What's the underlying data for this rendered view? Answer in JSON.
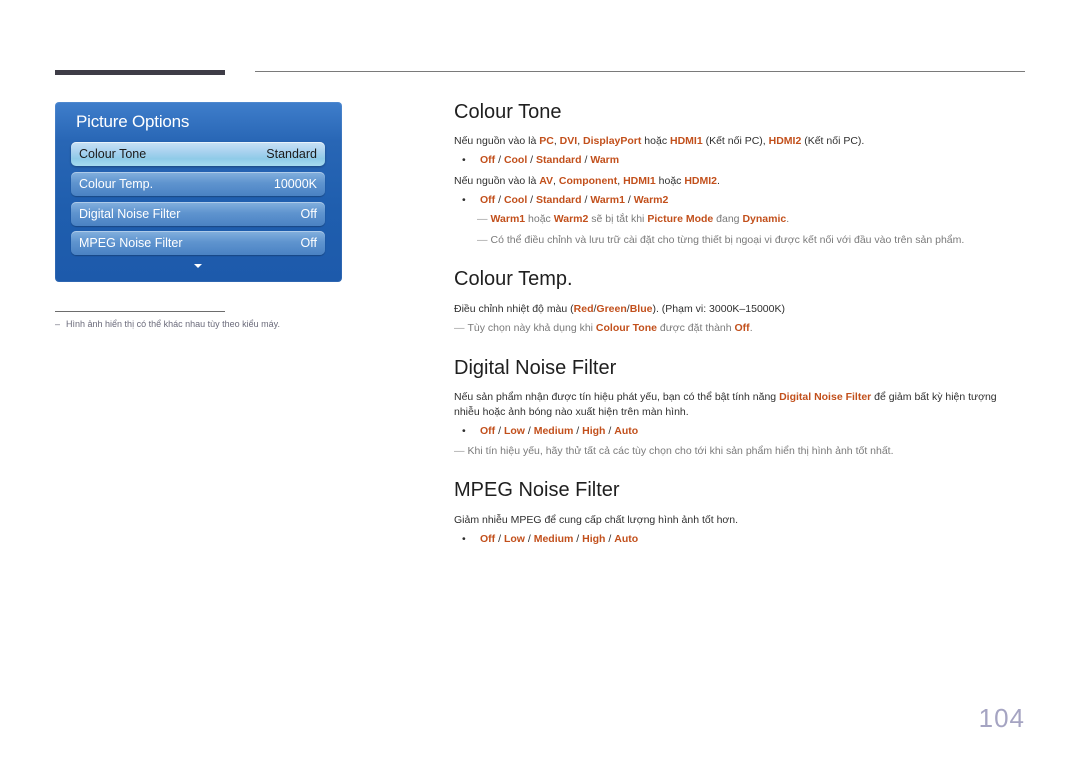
{
  "sidebar": {
    "panel_title": "Picture Options",
    "items": [
      {
        "label": "Colour Tone",
        "value": "Standard",
        "selected": true
      },
      {
        "label": "Colour Temp.",
        "value": "10000K",
        "selected": false
      },
      {
        "label": "Digital Noise Filter",
        "value": "Off",
        "selected": false
      },
      {
        "label": "MPEG Noise Filter",
        "value": "Off",
        "selected": false
      }
    ],
    "scroll_icon": "triangle-down-icon",
    "footnote_dash": "–",
    "footnote": "Hình ảnh hiển thị có thể khác nhau tùy theo kiểu máy."
  },
  "sections": {
    "colour_tone": {
      "title": "Colour Tone",
      "p1": {
        "t1": "Nếu nguồn vào là ",
        "h1": "PC",
        "t2": ", ",
        "h2": "DVI",
        "t3": ", ",
        "h3": "DisplayPort",
        "t4": " hoặc ",
        "h4": "HDMI1",
        "t5": " (Kết nối PC), ",
        "h5": "HDMI2",
        "t6": " (Kết nối PC)."
      },
      "options1": [
        "Off",
        "Cool",
        "Standard",
        "Warm"
      ],
      "p2": {
        "t1": "Nếu nguồn vào là ",
        "h1": "AV",
        "t2": ", ",
        "h2": "Component",
        "t3": ", ",
        "h3": "HDMI1",
        "t4": " hoặc ",
        "h4": "HDMI2",
        "t5": "."
      },
      "options2": [
        "Off",
        "Cool",
        "Standard",
        "Warm1",
        "Warm2"
      ],
      "note1": {
        "h1": "Warm1",
        "t1": " hoặc ",
        "h2": "Warm2",
        "t2": " sẽ bị tắt khi ",
        "h3": "Picture Mode",
        "t3": " đang ",
        "h4": "Dynamic",
        "t4": "."
      },
      "note2": "Có thể điều chỉnh và lưu trữ cài đặt cho từng thiết bị ngoại vi được kết nối với đầu vào trên sản phẩm."
    },
    "colour_temp": {
      "title": "Colour Temp.",
      "p1": {
        "t1": "Điều chỉnh nhiệt độ màu (",
        "h1": "Red",
        "t2": "/",
        "h2": "Green",
        "t3": "/",
        "h3": "Blue",
        "t4": "). (Phạm vi: 3000K–15000K)"
      },
      "note1": {
        "t1": "Tùy chọn này khả dụng khi ",
        "h1": "Colour Tone",
        "t2": " được đặt thành ",
        "h2": "Off",
        "t3": "."
      }
    },
    "digital_noise": {
      "title": "Digital Noise Filter",
      "p1": {
        "t1": "Nếu sản phẩm nhận được tín hiệu phát yếu, bạn có thể bật tính năng ",
        "h1": "Digital Noise Filter",
        "t2": " để giảm bất kỳ hiện tượng nhiễu hoặc ảnh bóng nào xuất hiện trên màn hình."
      },
      "options": [
        "Off",
        "Low",
        "Medium",
        "High",
        "Auto"
      ],
      "note1": "Khi tín hiệu yếu, hãy thử tất cả các tùy chọn cho tới khi sản phẩm hiển thị hình ảnh tốt nhất."
    },
    "mpeg_noise": {
      "title": "MPEG Noise Filter",
      "p1": "Giảm nhiễu MPEG để cung cấp chất lượng hình ảnh tốt hơn.",
      "options": [
        "Off",
        "Low",
        "Medium",
        "High",
        "Auto"
      ]
    }
  },
  "symbols": {
    "bullet": "•",
    "separator": " / ",
    "note_dash": "―"
  },
  "page_number": "104",
  "colors": {
    "highlight": "#c2501c",
    "panel": "#1f5eae",
    "page_number": "#a5a4c2"
  }
}
